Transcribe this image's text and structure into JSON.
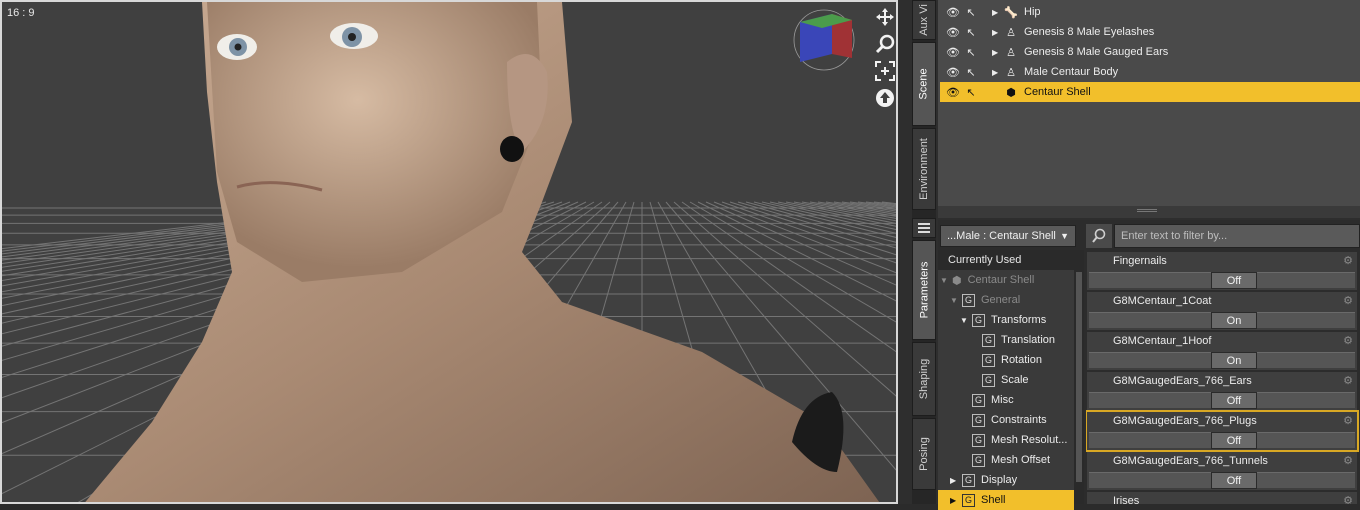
{
  "viewport": {
    "aspect_label": "16 : 9",
    "tools": [
      {
        "name": "move-view-icon"
      },
      {
        "name": "zoom-view-icon"
      },
      {
        "name": "frame-view-icon"
      },
      {
        "name": "home-view-icon"
      }
    ]
  },
  "tabs": {
    "aux_viewport": "Aux Vi",
    "scene": "Scene",
    "environment": "Environment",
    "parameters": "Parameters",
    "shaping": "Shaping",
    "posing": "Posing"
  },
  "scene_tree": {
    "rows": [
      {
        "label": "Hip",
        "icon": "bone-icon",
        "selected": false
      },
      {
        "label": "Genesis 8 Male Eyelashes",
        "icon": "figure-icon",
        "selected": false
      },
      {
        "label": "Genesis 8 Male Gauged Ears",
        "icon": "figure-icon",
        "selected": false
      },
      {
        "label": "Male Centaur Body",
        "icon": "figure-icon",
        "selected": false
      },
      {
        "label": "Centaur Shell",
        "icon": "shell-icon",
        "selected": true
      }
    ]
  },
  "parameters": {
    "node_select": "...Male : Centaur Shell",
    "filter_placeholder": "Enter text to filter by...",
    "tree": [
      {
        "label": "Currently Used",
        "level": 0,
        "kind": "head"
      },
      {
        "label": "Centaur Shell",
        "level": 0,
        "kind": "root"
      },
      {
        "label": "General",
        "level": 1,
        "kind": "group-dim"
      },
      {
        "label": "Transforms",
        "level": 2,
        "kind": "group"
      },
      {
        "label": "Translation",
        "level": 3,
        "kind": "leaf"
      },
      {
        "label": "Rotation",
        "level": 3,
        "kind": "leaf"
      },
      {
        "label": "Scale",
        "level": 3,
        "kind": "leaf"
      },
      {
        "label": "Misc",
        "level": 2,
        "kind": "leaf"
      },
      {
        "label": "Constraints",
        "level": 2,
        "kind": "leaf"
      },
      {
        "label": "Mesh Resolut...",
        "level": 2,
        "kind": "leaf"
      },
      {
        "label": "Mesh Offset",
        "level": 2,
        "kind": "leaf"
      },
      {
        "label": "Display",
        "level": 1,
        "kind": "group-collapsed"
      },
      {
        "label": "Shell",
        "level": 1,
        "kind": "selected"
      }
    ],
    "properties": [
      {
        "name": "Fingernails",
        "value": "Off",
        "highlighted": false
      },
      {
        "name": "G8MCentaur_1Coat",
        "value": "On",
        "highlighted": false
      },
      {
        "name": "G8MCentaur_1Hoof",
        "value": "On",
        "highlighted": false
      },
      {
        "name": "G8MGaugedEars_766_Ears",
        "value": "Off",
        "highlighted": false
      },
      {
        "name": "G8MGaugedEars_766_Plugs",
        "value": "Off",
        "highlighted": true
      },
      {
        "name": "G8MGaugedEars_766_Tunnels",
        "value": "Off",
        "highlighted": false
      },
      {
        "name": "Irises",
        "value": "",
        "highlighted": false
      }
    ]
  },
  "colors": {
    "selection": "#f2bf2b",
    "panel": "#4a4a4a"
  }
}
